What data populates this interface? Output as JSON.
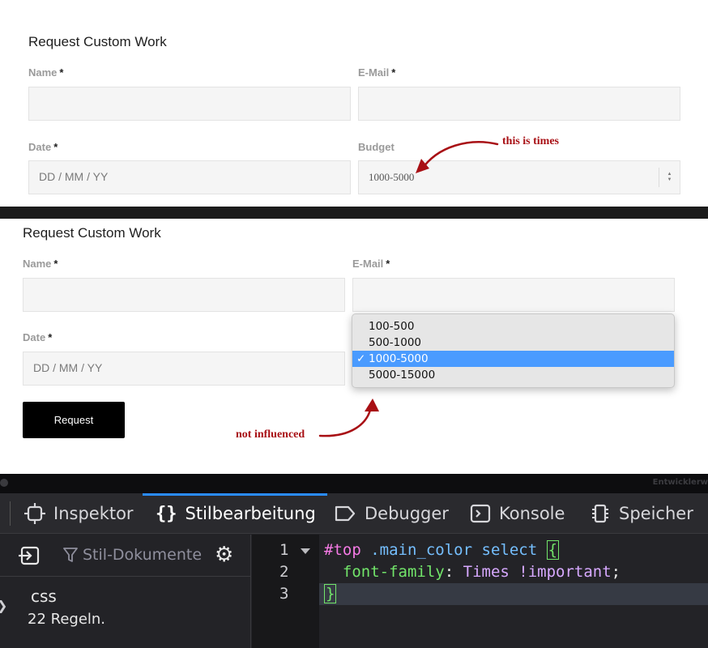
{
  "panel_top": {
    "title": "Request Custom Work",
    "fields": {
      "name_label": "Name",
      "email_label": "E-Mail",
      "date_label": "Date",
      "date_placeholder": "DD / MM / YY",
      "budget_label": "Budget",
      "budget_value": "1000-5000",
      "required_mark": "*"
    },
    "annotation": "this is times"
  },
  "panel_bottom": {
    "title": "Request Custom Work",
    "fields": {
      "name_label": "Name",
      "email_label": "E-Mail",
      "date_label": "Date",
      "date_placeholder": "DD / MM / YY",
      "required_mark": "*"
    },
    "dropdown": {
      "options": [
        "100-500",
        "500-1000",
        "1000-5000",
        "5000-15000"
      ],
      "selected": "1000-5000",
      "check_mark": "✓",
      "selected_color": "#4a9bff"
    },
    "submit_label": "Request",
    "annotation": "not influenced"
  },
  "annotation_color": "#a80f14",
  "devtools": {
    "window_title": "Entwicklerw",
    "tabs": [
      {
        "label": "Inspektor",
        "icon": "inspector-icon"
      },
      {
        "label": "Stilbearbeitung",
        "icon": "braces-icon",
        "active": true
      },
      {
        "label": "Debugger",
        "icon": "debugger-icon"
      },
      {
        "label": "Konsole",
        "icon": "console-icon"
      },
      {
        "label": "Speicher",
        "icon": "memory-icon"
      }
    ],
    "sidebar": {
      "filter_placeholder": "Stil-Dokumente",
      "sheet_name": "css",
      "sheet_rules": "22 Regeln."
    },
    "editor": {
      "line_numbers": [
        "1",
        "2",
        "3"
      ],
      "line1": {
        "id": "#top",
        "class": ".main_color",
        "tag": "select",
        "open": "{"
      },
      "line2": {
        "property": "font-family",
        "colon": ":",
        "value": "Times !important",
        "semicolon": ";"
      },
      "line3": {
        "close": "}"
      }
    },
    "accent_color": "#2a8cff"
  }
}
